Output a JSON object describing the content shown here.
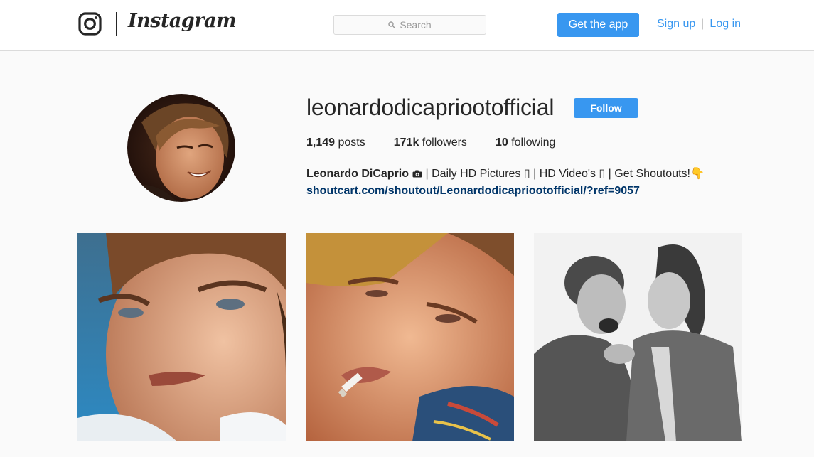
{
  "header": {
    "logo_icon": "instagram-camera-icon",
    "wordmark": "Instagram",
    "search": {
      "placeholder": "Search",
      "icon": "search-icon"
    },
    "get_app_label": "Get the app",
    "signup_label": "Sign up",
    "separator": "|",
    "login_label": "Log in"
  },
  "profile": {
    "avatar_icon": "profile-avatar",
    "username": "leonardodicapriootofficial",
    "follow_label": "Follow",
    "stats": {
      "posts_count": "1,149",
      "posts_label": "posts",
      "followers_count": "171k",
      "followers_label": "followers",
      "following_count": "10",
      "following_label": "following"
    },
    "bio": {
      "full_name": "Leonardo DiCaprio",
      "camera_icon": "camera-emoji-icon",
      "text": " | Daily HD Pictures ▯ | HD Video's ▯ | Get Shoutouts!👇",
      "url": "shoutcart.com/shoutout/Leonardodicapriootofficial/?ref=9057"
    }
  },
  "posts": [
    {
      "label": "post-1"
    },
    {
      "label": "post-2"
    },
    {
      "label": "post-3"
    }
  ],
  "colors": {
    "accent": "#3897f0",
    "link": "#003569",
    "background": "#fafafa",
    "border": "#dbdbdb"
  }
}
